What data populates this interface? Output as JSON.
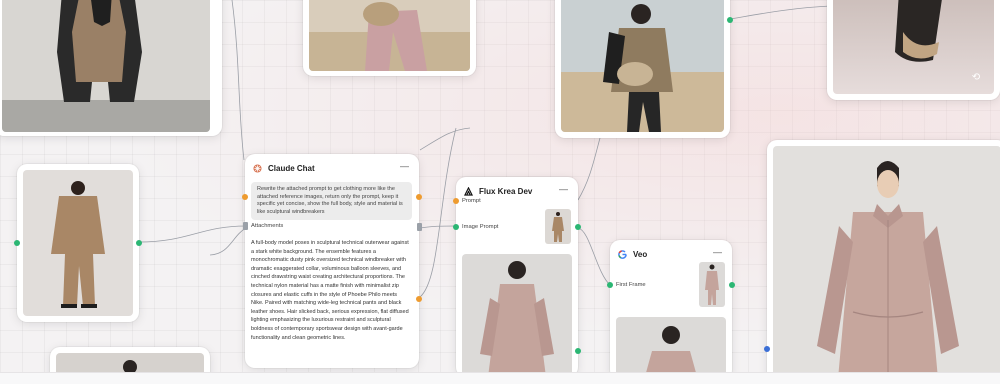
{
  "claude_node": {
    "title": "Claude Chat",
    "minimize_label": "—",
    "prompt": "Rewrite the attached prompt to get clothing more like the attached reference images, return only the prompt, keep it specific yet concise, show the full body, style and material is like sculptural windbreakers",
    "attachments_label": "Attachments",
    "output": "A full-body model poses in sculptural technical outerwear against a stark white background. The ensemble features a monochromatic dusty pink oversized technical windbreaker with dramatic exaggerated collar, voluminous balloon sleeves, and cinched drawstring waist creating architectural proportions. The technical nylon material has a matte finish with minimalist zip closures and elastic cuffs in the style of Phoebe Philo meets Nike. Paired with matching wide-leg technical pants and black leather shoes. Hair slicked back, serious expression, flat diffused lighting emphasizing the luxurious restraint and sculptural boldness of contemporary sportswear design with avant-garde functionality and clean geometric lines."
  },
  "flux_node": {
    "title": "Flux Krea Dev",
    "minimize_label": "—",
    "prompt_label": "Prompt",
    "image_prompt_label": "Image Prompt"
  },
  "veo_node": {
    "title": "Veo",
    "minimize_label": "—",
    "first_frame_label": "First Frame"
  },
  "icons": {
    "claude": "claude-logo-icon",
    "flux": "flux-logo-icon",
    "veo": "google-logo-icon",
    "refresh": "refresh-icon"
  },
  "colors": {
    "port_green": "#2bb673",
    "port_orange": "#ee9b2f",
    "port_blue": "#3b6fd6",
    "claude_orange": "#d97757"
  }
}
